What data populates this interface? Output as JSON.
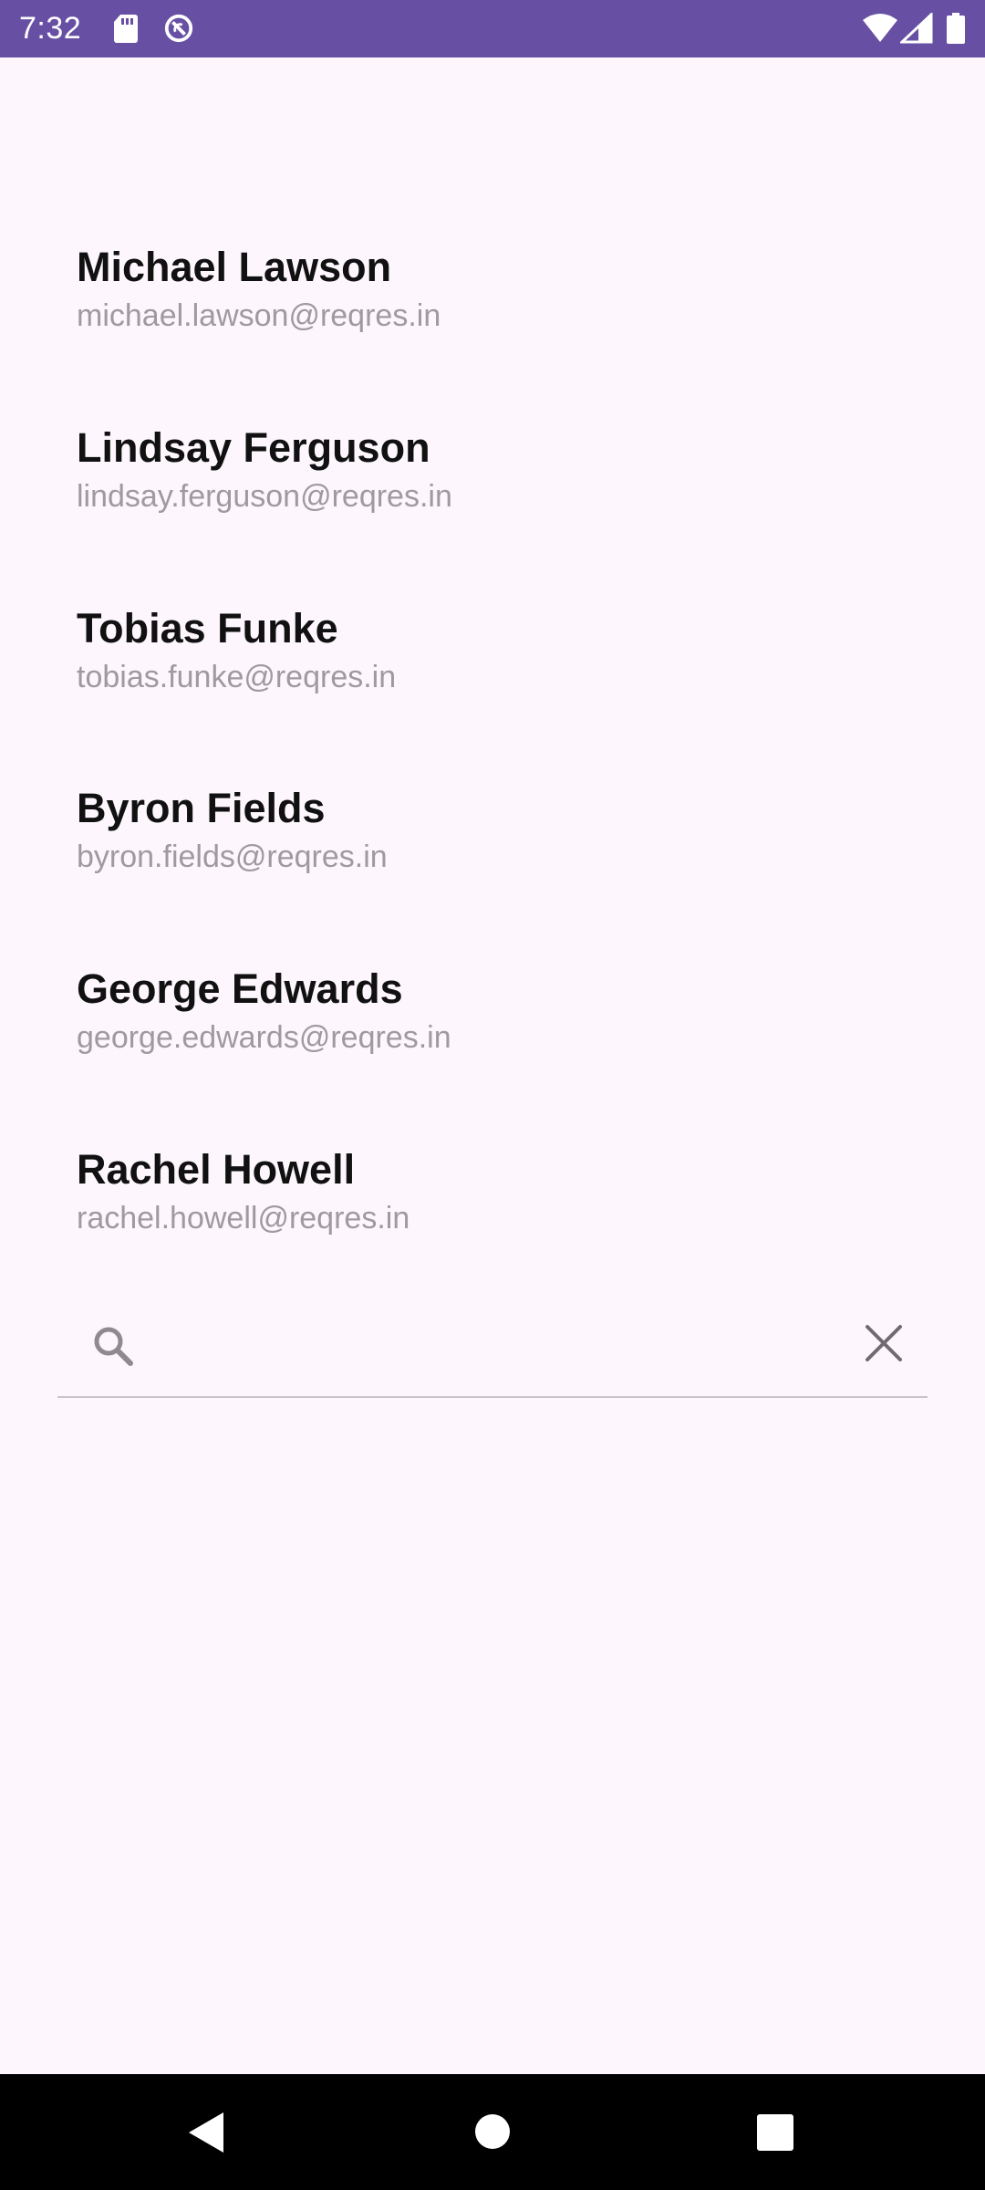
{
  "status_bar": {
    "time": "7:32",
    "background": "#6750A4",
    "icons": [
      "sd-card-icon",
      "do-not-disturb-icon",
      "wifi-icon",
      "signal-icon",
      "battery-icon"
    ]
  },
  "users": [
    {
      "name": "Michael Lawson",
      "email": "michael.lawson@reqres.in"
    },
    {
      "name": "Lindsay Ferguson",
      "email": "lindsay.ferguson@reqres.in"
    },
    {
      "name": "Tobias Funke",
      "email": "tobias.funke@reqres.in"
    },
    {
      "name": "Byron Fields",
      "email": "byron.fields@reqres.in"
    },
    {
      "name": "George Edwards",
      "email": "george.edwards@reqres.in"
    },
    {
      "name": "Rachel Howell",
      "email": "rachel.howell@reqres.in"
    }
  ],
  "search": {
    "value": "",
    "placeholder": "",
    "icons": [
      "search-icon",
      "close-icon"
    ]
  },
  "nav_bar": {
    "icons": [
      "back-icon",
      "home-icon",
      "recents-icon"
    ]
  },
  "colors": {
    "background": "#FDF7FD",
    "name_text": "#111111",
    "email_text": "#9E9A9E",
    "accent": "#6750A4"
  }
}
